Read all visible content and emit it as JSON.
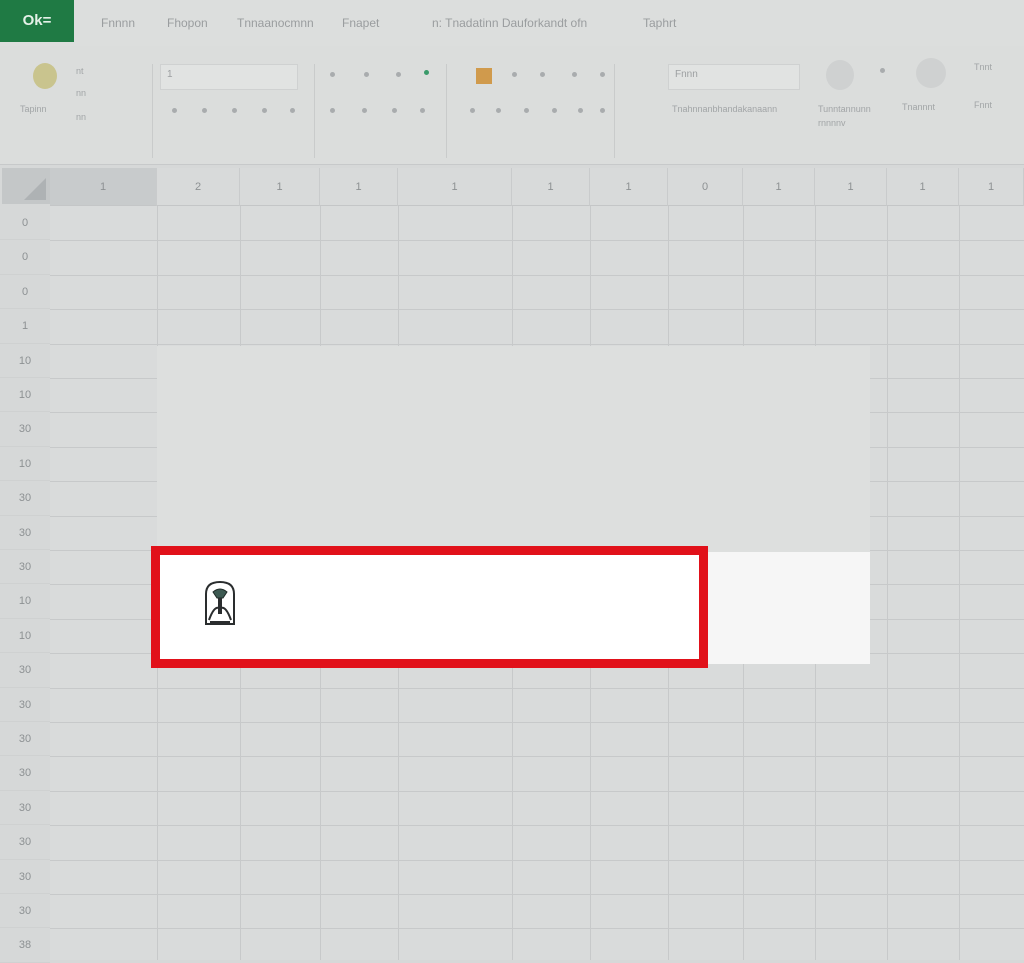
{
  "app": {
    "badge_text": "Ok=",
    "brand_color": "#1f7a44"
  },
  "menu": {
    "tabs": [
      "Fnnnn",
      "Fhopon",
      "Tnnaanocmnn",
      "Fnapet",
      "n: Tnadatinn Dauforkandt  ofn",
      "Taphrt"
    ]
  },
  "ribbon": {
    "paste_label": "Tapinn",
    "font_box_value": "1",
    "style_field_value": "Fnnn",
    "style_caption": "Tnahnnanbhandakanaann",
    "group_caption_1": "Tunntannunn",
    "group_caption_2": "rnnnnv",
    "group_caption_3": "Tnannnt",
    "group_caption_4": "Tnnt",
    "group_caption_5": "Fnnt",
    "small_labels": [
      "nt",
      "nn",
      "nn"
    ]
  },
  "columns": [
    "1",
    "2",
    "1",
    "1",
    "1",
    "1",
    "1",
    "0",
    "1",
    "1",
    "1",
    "1"
  ],
  "rows": [
    "0",
    "0",
    "0",
    "1",
    "10",
    "10",
    "30",
    "10",
    "30",
    "30",
    "30",
    "10",
    "10",
    "30",
    "30",
    "30",
    "30",
    "30",
    "30",
    "30",
    "30",
    "38"
  ],
  "dialog": {
    "highlight_color": "#e1111a",
    "icon": "trophy-figure-icon"
  }
}
